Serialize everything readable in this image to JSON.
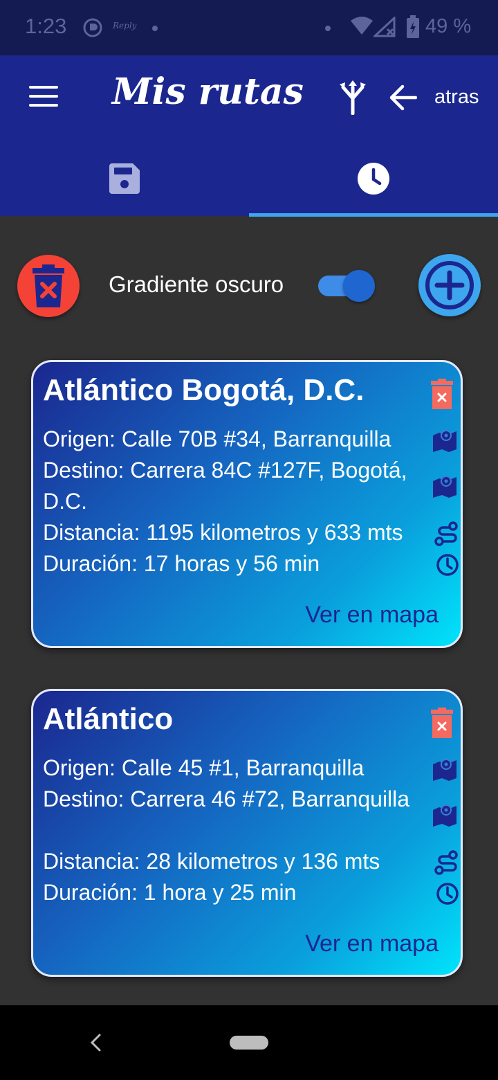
{
  "status_bar": {
    "time": "1:23",
    "app_text": "Reply",
    "battery": "49 %"
  },
  "app_bar": {
    "title": "Mis rutas",
    "back_label": "atras"
  },
  "tabs": [
    {
      "icon": "save-icon",
      "selected": false
    },
    {
      "icon": "clock-icon",
      "selected": true
    }
  ],
  "controls": {
    "gradient_label": "Gradiente oscuro",
    "gradient_on": true
  },
  "routes": [
    {
      "title": "Atlántico Bogotá, D.C.",
      "origin": "Origen: Calle 70B #34, Barranquilla",
      "destination": "Destino: Carrera 84C #127F, Bogotá, D.C.",
      "distance": "Distancia: 1195 kilometros y 633 mts",
      "duration": "Duración: 17 horas y 56 min",
      "map_link": "Ver en mapa"
    },
    {
      "title": "Atlántico",
      "origin": "Origen: Calle 45 #1, Barranquilla",
      "destination": "Destino: Carrera 46 #72, Barranquilla",
      "distance": "Distancia: 28 kilometros y 136 mts",
      "duration": "Duración: 1 hora y 25 min",
      "map_link": "Ver en mapa"
    }
  ],
  "colors": {
    "app_bar": "#1b278f",
    "accent": "#3ea6ee",
    "danger": "#f44336",
    "background": "#323232"
  }
}
